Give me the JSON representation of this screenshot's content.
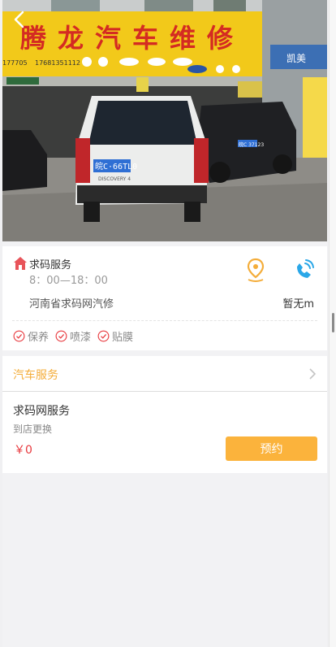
{
  "hero": {
    "sign_text": "腾龙汽车维修",
    "phone_left": "177705",
    "phone_right": "17681351112",
    "plate_front": "皖C·66TL0",
    "plate_back": "皖C 37123",
    "car_model": "DISCOVERY 4"
  },
  "shop": {
    "name": "求码服务",
    "hours": "8：00—18：00",
    "address": "河南省求码网汽修",
    "distance": "暂无m",
    "tags": [
      "保养",
      "喷漆",
      "贴膜"
    ]
  },
  "service_section": {
    "title": "汽车服务"
  },
  "service_item": {
    "name": "求码网服务",
    "desc": "到店更换",
    "price": "￥0",
    "book_label": "预约"
  },
  "colors": {
    "accent": "#f4ad3a",
    "button": "#fbb33c",
    "price": "#e8383d",
    "phone_icon": "#2aa7e8",
    "tag_icon": "#e8383d"
  }
}
